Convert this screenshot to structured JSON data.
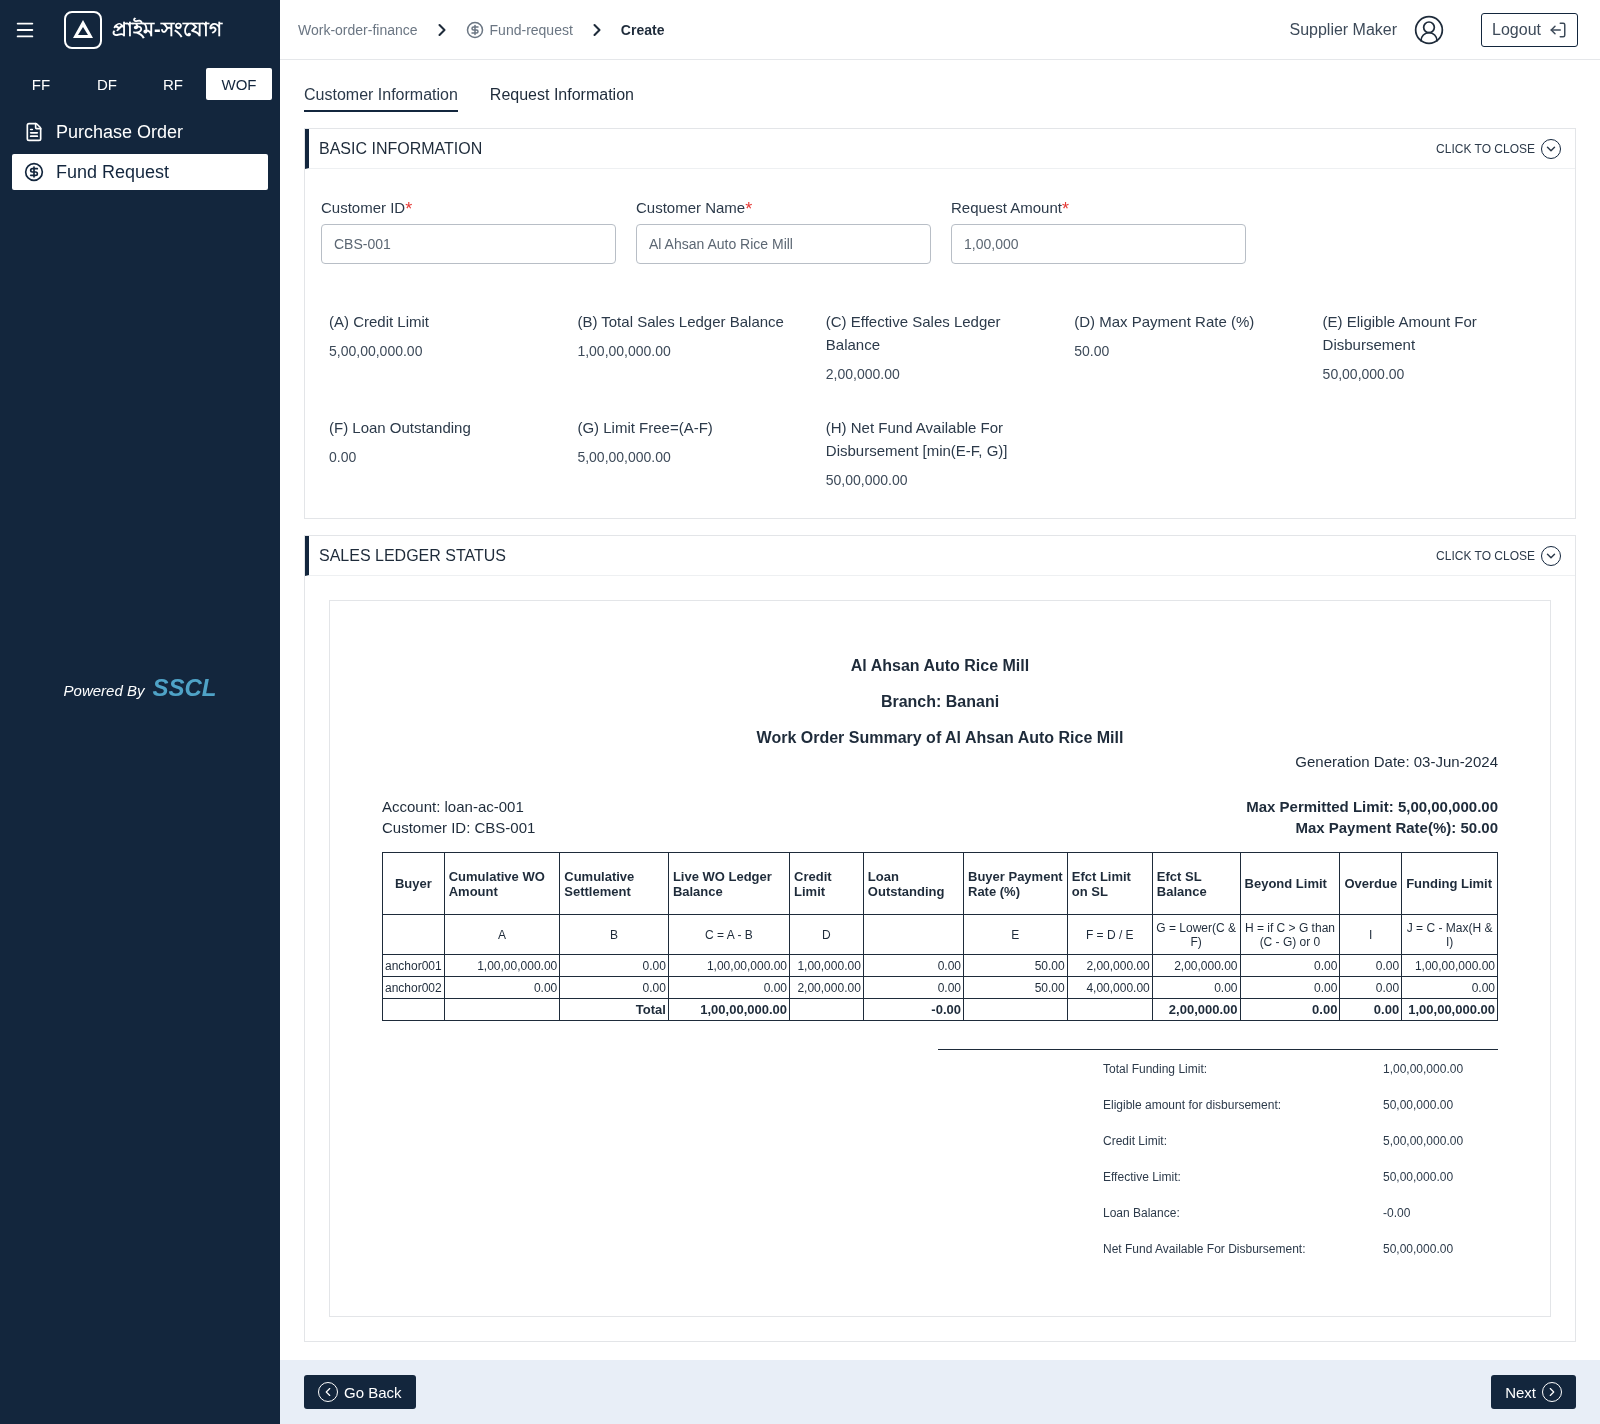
{
  "sidebar": {
    "logo_text": "প্রাইম-সংযোগ",
    "modes": [
      {
        "label": "FF",
        "selected": false
      },
      {
        "label": "DF",
        "selected": false
      },
      {
        "label": "RF",
        "selected": false
      },
      {
        "label": "WOF",
        "selected": true
      }
    ],
    "items": [
      {
        "label": "Purchase Order",
        "kind": "order",
        "selected": false
      },
      {
        "label": "Fund Request",
        "kind": "fund",
        "selected": true
      }
    ],
    "powered_by": {
      "label": "Powered By",
      "brand": "SSCL"
    }
  },
  "header": {
    "breadcrumbs": [
      {
        "label": "Work-order-finance",
        "kind": "plain",
        "current": false
      },
      {
        "label": "Fund-request",
        "kind": "fund",
        "current": false
      },
      {
        "label": "Create",
        "kind": "plain",
        "current": true
      }
    ],
    "user": "Supplier Maker",
    "logout": "Logout"
  },
  "tabs": [
    {
      "label": "Customer Information",
      "selected": true
    },
    {
      "label": "Request Information",
      "selected": false
    }
  ],
  "basic_information": {
    "title": "BASIC INFORMATION",
    "toggle": "CLICK TO CLOSE",
    "fields": [
      {
        "label": "Customer ID",
        "required_mark": "*",
        "value": "CBS-001"
      },
      {
        "label": "Customer Name",
        "required_mark": "*",
        "value": "Al Ahsan Auto Rice Mill"
      },
      {
        "label": "Request Amount",
        "required_mark": "*",
        "value": "1,00,000"
      }
    ],
    "metrics": [
      {
        "label": "(A) Credit Limit",
        "value": "5,00,00,000.00"
      },
      {
        "label": "(B) Total Sales Ledger Balance",
        "value": "1,00,00,000.00"
      },
      {
        "label": "(C) Effective Sales Ledger Balance",
        "value": "2,00,000.00"
      },
      {
        "label": "(D) Max Payment Rate (%)",
        "value": "50.00"
      },
      {
        "label": "(E) Eligible Amount For Disbursement",
        "value": "50,00,000.00"
      },
      {
        "label": "(F) Loan Outstanding",
        "value": "0.00"
      },
      {
        "label": "(G) Limit Free=(A-F)",
        "value": "5,00,00,000.00"
      },
      {
        "label": "(H) Net Fund Available For Disbursement [min(E-F, G)]",
        "value": "50,00,000.00"
      }
    ]
  },
  "sales_ledger_status": {
    "title": "SALES LEDGER STATUS",
    "toggle": "CLICK TO CLOSE",
    "report": {
      "company": "Al Ahsan Auto Rice Mill",
      "branch": "Branch: Banani",
      "summary_title": "Work Order Summary of Al Ahsan Auto Rice Mill",
      "generation_date": "Generation Date: 03-Jun-2024",
      "account": "Account: loan-ac-001",
      "customer_id": "Customer ID: CBS-001",
      "max_permitted_limit": "Max Permitted Limit: 5,00,00,000.00",
      "max_payment_rate": "Max Payment Rate(%): 50.00",
      "table": {
        "columns": [
          "Buyer",
          "Cumulative WO Amount",
          "Cumulative Settlement",
          "Live WO Ledger Balance",
          "Credit Limit",
          "Loan Outstanding",
          "Buyer Payment Rate (%)",
          "Efct Limit on SL",
          "Efct SL Balance",
          "Beyond Limit",
          "Overdue",
          "Funding Limit"
        ],
        "formulas": {
          "cum_wo": "A",
          "cum_settle": "B",
          "live_wo": "C = A - B",
          "credit": "D",
          "rate": "E",
          "efct_limit": "F = D / E",
          "efct_sl": "G = Lower(C & F)",
          "beyond": "H = if C > G than (C - G) or 0",
          "overdue": "I",
          "funding": "J = C - Max(H & I)"
        },
        "rows": [
          {
            "buyer": "anchor001",
            "cum_wo": "1,00,00,000.00",
            "cum_settle": "0.00",
            "live_wo": "1,00,00,000.00",
            "credit": "1,00,000.00",
            "loan": "0.00",
            "rate": "50.00",
            "efct_limit": "2,00,000.00",
            "efct_sl": "2,00,000.00",
            "beyond": "0.00",
            "overdue": "0.00",
            "funding": "1,00,00,000.00"
          },
          {
            "buyer": "anchor002",
            "cum_wo": "0.00",
            "cum_settle": "0.00",
            "live_wo": "0.00",
            "credit": "2,00,000.00",
            "loan": "0.00",
            "rate": "50.00",
            "efct_limit": "4,00,000.00",
            "efct_sl": "0.00",
            "beyond": "0.00",
            "overdue": "0.00",
            "funding": "0.00"
          }
        ],
        "total": {
          "cum_settle": "Total",
          "live_wo": "1,00,00,000.00",
          "loan": "-0.00",
          "efct_sl": "2,00,000.00",
          "beyond": "0.00",
          "overdue": "0.00",
          "funding": "1,00,00,000.00"
        }
      },
      "summary": [
        {
          "label": "Total Funding Limit:",
          "value": "1,00,00,000.00"
        },
        {
          "label": "Eligible amount for disbursement:",
          "value": "50,00,000.00"
        },
        {
          "label": "Credit Limit:",
          "value": "5,00,00,000.00"
        },
        {
          "label": "Effective Limit:",
          "value": "50,00,000.00"
        },
        {
          "label": "Loan Balance:",
          "value": "-0.00"
        },
        {
          "label": "Net Fund Available For Disbursement:",
          "value": "50,00,000.00"
        }
      ]
    }
  },
  "footer": {
    "back": "Go Back",
    "next": "Next"
  }
}
